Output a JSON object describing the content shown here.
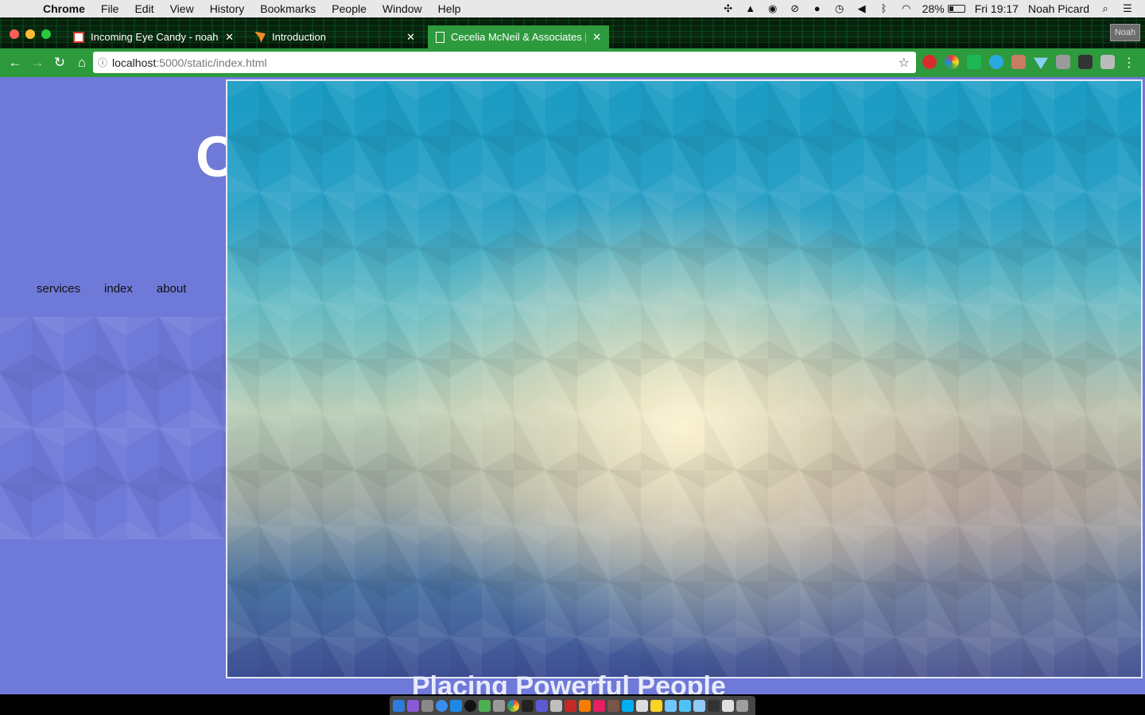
{
  "menubar": {
    "app_name": "Chrome",
    "menus": [
      "File",
      "Edit",
      "View",
      "History",
      "Bookmarks",
      "People",
      "Window",
      "Help"
    ],
    "battery": "28%",
    "clock": "Fri 19:17",
    "user": "Noah Picard"
  },
  "tabs": [
    {
      "title": "Incoming Eye Candy - noahapi",
      "icon": "gmail-icon",
      "active": false
    },
    {
      "title": "Introduction",
      "icon": "swift-icon",
      "active": false
    },
    {
      "title": "Cecelia McNeil & Associates | C",
      "icon": "document-icon",
      "active": true
    }
  ],
  "profile_button": "Noah",
  "omnibox": {
    "host": "localhost",
    "path": ":5000/static/index.html"
  },
  "page": {
    "hero_letter": "C",
    "nav": [
      "services",
      "index",
      "about"
    ],
    "tagline": "Placing Powerful People"
  },
  "colors": {
    "page_bg": "#6f79d8",
    "toolbar": "#2e9a3e",
    "active_tab": "#2e9a3e"
  }
}
